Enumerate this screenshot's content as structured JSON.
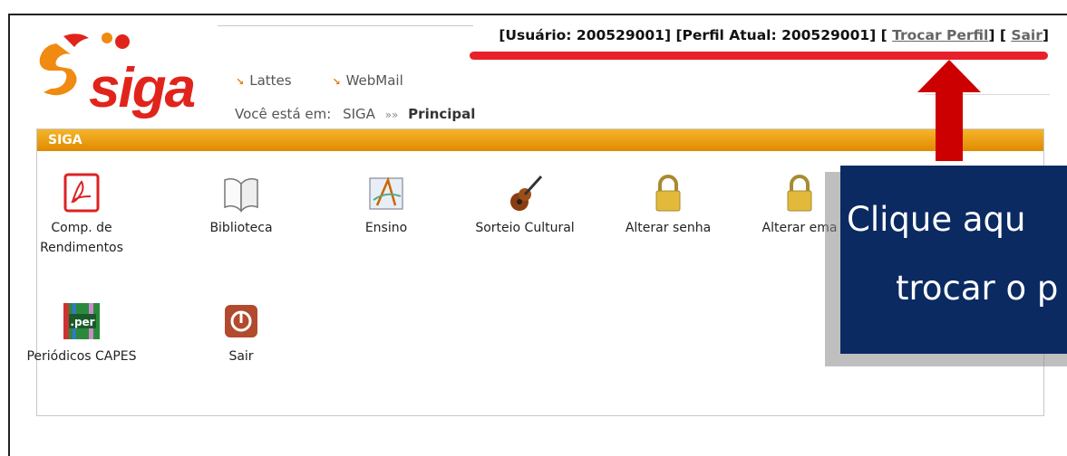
{
  "userbar": {
    "usuario": "[Usuário: 200529001]",
    "perfil": "[Perfil Atual: 200529001]",
    "open1": "[",
    "trocar": "Trocar Perfil",
    "close1": "]",
    "open2": "[",
    "sair": "Sair",
    "close2": "]"
  },
  "logo": {
    "text": "siga"
  },
  "toplinks": [
    {
      "label": "Lattes"
    },
    {
      "label": "WebMail"
    }
  ],
  "breadcrumb": {
    "prefix": "Você está em:",
    "root": "SIGA",
    "sep": "»»",
    "current": "Principal"
  },
  "panel": {
    "title": "SIGA"
  },
  "tiles": [
    {
      "label": "Comp. de Rendimentos",
      "icon": "pdf-icon"
    },
    {
      "label": "Biblioteca",
      "icon": "book-icon"
    },
    {
      "label": "Ensino",
      "icon": "compass-icon"
    },
    {
      "label": "Sorteio Cultural",
      "icon": "guitar-icon"
    },
    {
      "label": "Alterar senha",
      "icon": "lock-icon"
    },
    {
      "label": "Alterar ema",
      "icon": "lock-icon"
    },
    {
      "label": "Periódicos CAPES",
      "icon": "periodicos-icon"
    },
    {
      "label": "Sair",
      "icon": "power-icon"
    }
  ],
  "callout": {
    "line1": "Clique aqu",
    "line2": "trocar o p"
  },
  "colors": {
    "brand": "#e1241b",
    "header": "#f0a010",
    "callout": "#0b2a62",
    "highlight": "#e8202a"
  }
}
